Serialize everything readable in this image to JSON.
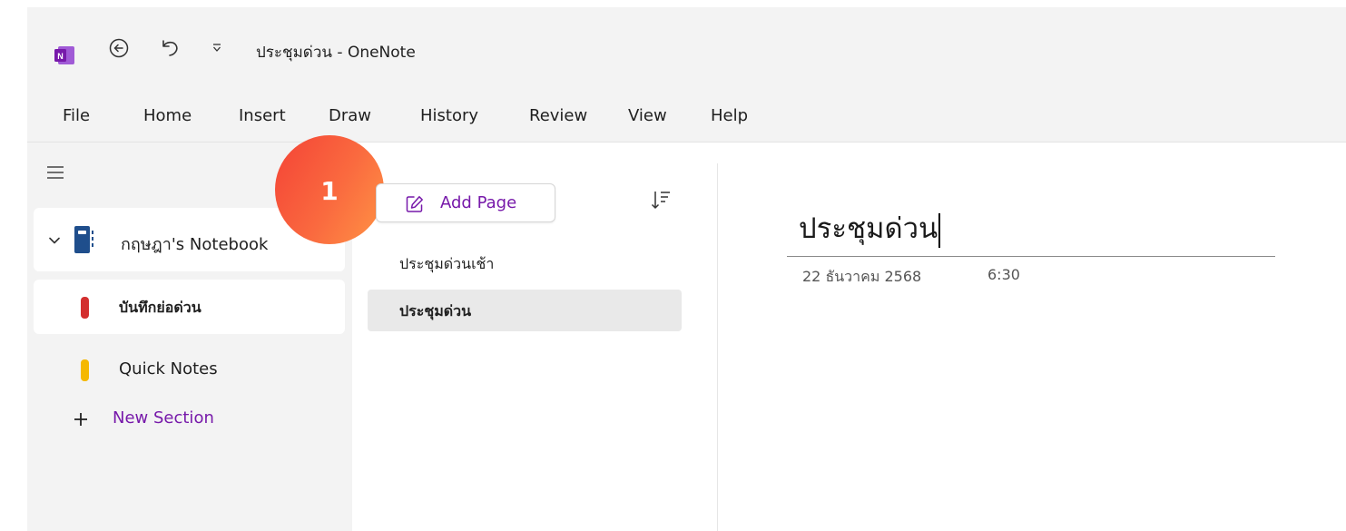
{
  "titlebar": {
    "title": "ประชุมด่วน - OneNote",
    "icons": [
      "onenote-app-icon",
      "back-icon",
      "undo-icon",
      "quick-access-dropdown-icon"
    ]
  },
  "menu": {
    "items": [
      "File",
      "Home",
      "Insert",
      "Draw",
      "History",
      "Review",
      "View",
      "Help"
    ]
  },
  "navigation": {
    "notebook_name": "กฤษฎา's Notebook",
    "sections": [
      {
        "label": "บันทึกย่อด่วน",
        "color": "#d32f2f",
        "selected": true
      },
      {
        "label": "Quick Notes",
        "color": "#f5b800",
        "selected": false
      }
    ],
    "new_section_label": "New Section"
  },
  "callout": {
    "number": "1"
  },
  "pages_pane": {
    "add_page_label": "Add Page",
    "pages": [
      {
        "title": "ประชุมด่วนเช้า",
        "selected": false
      },
      {
        "title": "ประชุมด่วน",
        "selected": true
      }
    ]
  },
  "page": {
    "title": "ประชุมด่วน",
    "date": "22 ธันวาคม 2568",
    "time": "6:30"
  },
  "colors": {
    "accent": "#7719aa",
    "onenote_purple": "#7719aa",
    "notebook_icon": "#1f4e8c"
  }
}
